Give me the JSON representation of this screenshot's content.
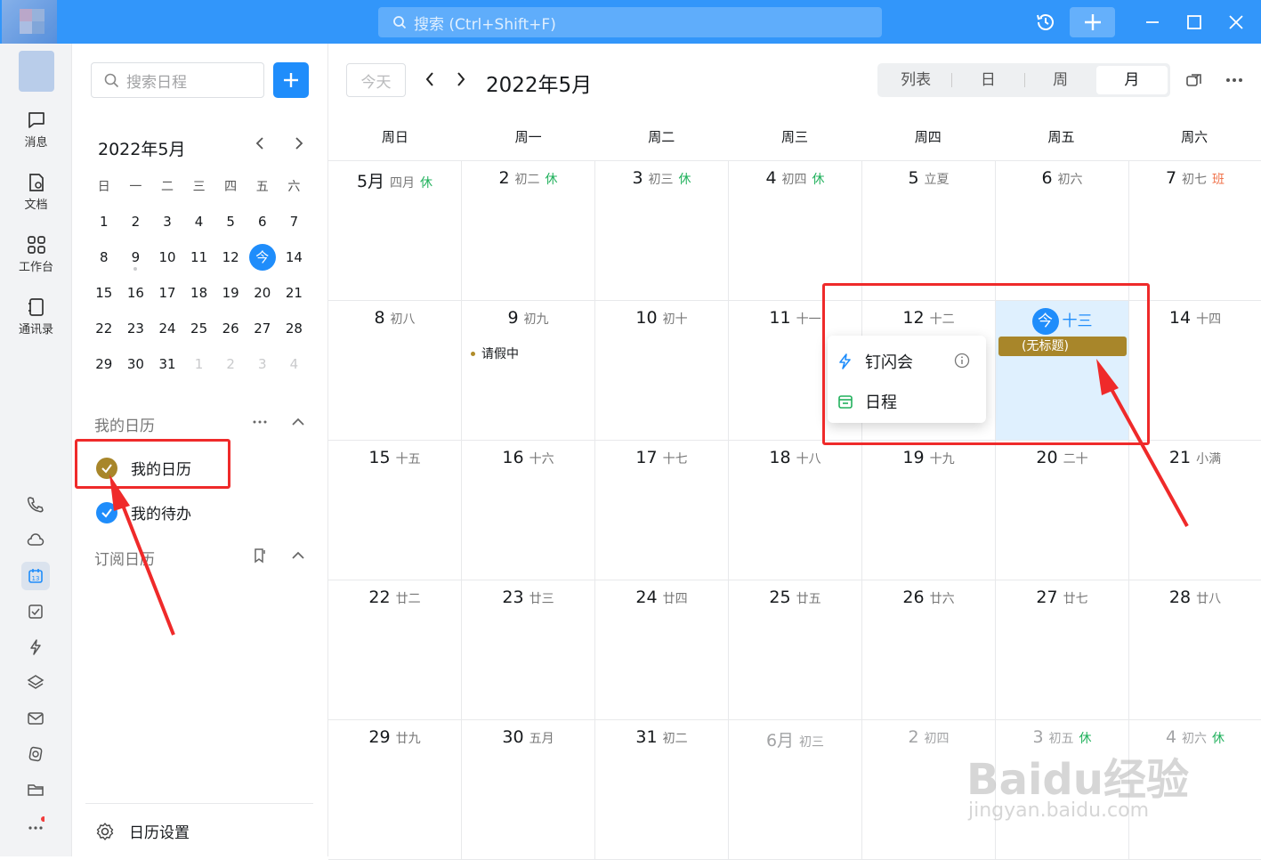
{
  "titlebar": {
    "search_placeholder": "搜索 (Ctrl+Shift+F)"
  },
  "leftnav": {
    "items": [
      {
        "label": "消息",
        "icon": "message-icon"
      },
      {
        "label": "文档",
        "icon": "doc-icon"
      },
      {
        "label": "工作台",
        "icon": "workbench-icon"
      },
      {
        "label": "通讯录",
        "icon": "contacts-icon"
      }
    ]
  },
  "sidebar": {
    "search_placeholder": "搜索日程",
    "mini_calendar": {
      "title": "2022年5月",
      "weekdays": [
        "日",
        "一",
        "二",
        "三",
        "四",
        "五",
        "六"
      ],
      "weeks": [
        [
          "1",
          "2",
          "3",
          "4",
          "5",
          "6",
          "7"
        ],
        [
          "8",
          "9",
          "10",
          "11",
          "12",
          "今",
          "14"
        ],
        [
          "15",
          "16",
          "17",
          "18",
          "19",
          "20",
          "21"
        ],
        [
          "22",
          "23",
          "24",
          "25",
          "26",
          "27",
          "28"
        ],
        [
          "29",
          "30",
          "31",
          "1",
          "2",
          "3",
          "4"
        ]
      ]
    },
    "my_calendars_title": "我的日历",
    "my_calendars": [
      {
        "label": "我的日历",
        "color": "#a8862a"
      },
      {
        "label": "我的待办",
        "color": "#1f8dfb"
      }
    ],
    "subscribed_title": "订阅日历",
    "settings_label": "日历设置"
  },
  "main": {
    "today_button": "今天",
    "title": "2022年5月",
    "views": [
      "列表",
      "日",
      "周",
      "月"
    ],
    "active_view": "月",
    "weekday_headers": [
      "周日",
      "周一",
      "周二",
      "周三",
      "周四",
      "周五",
      "周六"
    ],
    "weeks": [
      [
        {
          "num": "5月",
          "lunar": "四月",
          "tag": "休",
          "tag_type": "hol"
        },
        {
          "num": "2",
          "lunar": "初二",
          "tag": "休",
          "tag_type": "hol"
        },
        {
          "num": "3",
          "lunar": "初三",
          "tag": "休",
          "tag_type": "hol"
        },
        {
          "num": "4",
          "lunar": "初四",
          "tag": "休",
          "tag_type": "hol"
        },
        {
          "num": "5",
          "lunar": "立夏",
          "tag": "",
          "tag_type": ""
        },
        {
          "num": "6",
          "lunar": "初六",
          "tag": "",
          "tag_type": ""
        },
        {
          "num": "7",
          "lunar": "初七",
          "tag": "班",
          "tag_type": "ban"
        }
      ],
      [
        {
          "num": "8",
          "lunar": "初八",
          "tag": "",
          "tag_type": ""
        },
        {
          "num": "9",
          "lunar": "初九",
          "tag": "",
          "tag_type": ""
        },
        {
          "num": "10",
          "lunar": "初十",
          "tag": "",
          "tag_type": ""
        },
        {
          "num": "11",
          "lunar": "十一",
          "tag": "",
          "tag_type": ""
        },
        {
          "num": "12",
          "lunar": "十二",
          "tag": "",
          "tag_type": ""
        },
        {
          "num": "今",
          "lunar": "十三",
          "tag": "",
          "tag_type": "today"
        },
        {
          "num": "14",
          "lunar": "十四",
          "tag": "",
          "tag_type": ""
        }
      ],
      [
        {
          "num": "15",
          "lunar": "十五",
          "tag": "",
          "tag_type": ""
        },
        {
          "num": "16",
          "lunar": "十六",
          "tag": "",
          "tag_type": ""
        },
        {
          "num": "17",
          "lunar": "十七",
          "tag": "",
          "tag_type": ""
        },
        {
          "num": "18",
          "lunar": "十八",
          "tag": "",
          "tag_type": ""
        },
        {
          "num": "19",
          "lunar": "十九",
          "tag": "",
          "tag_type": ""
        },
        {
          "num": "20",
          "lunar": "二十",
          "tag": "",
          "tag_type": ""
        },
        {
          "num": "21",
          "lunar": "小满",
          "tag": "",
          "tag_type": ""
        }
      ],
      [
        {
          "num": "22",
          "lunar": "廿二",
          "tag": "",
          "tag_type": ""
        },
        {
          "num": "23",
          "lunar": "廿三",
          "tag": "",
          "tag_type": ""
        },
        {
          "num": "24",
          "lunar": "廿四",
          "tag": "",
          "tag_type": ""
        },
        {
          "num": "25",
          "lunar": "廿五",
          "tag": "",
          "tag_type": ""
        },
        {
          "num": "26",
          "lunar": "廿六",
          "tag": "",
          "tag_type": ""
        },
        {
          "num": "27",
          "lunar": "廿七",
          "tag": "",
          "tag_type": ""
        },
        {
          "num": "28",
          "lunar": "廿八",
          "tag": "",
          "tag_type": ""
        }
      ],
      [
        {
          "num": "29",
          "lunar": "廿九",
          "tag": "",
          "tag_type": ""
        },
        {
          "num": "30",
          "lunar": "五月",
          "tag": "",
          "tag_type": ""
        },
        {
          "num": "31",
          "lunar": "初二",
          "tag": "",
          "tag_type": ""
        },
        {
          "num": "6月",
          "lunar": "初三",
          "tag": "",
          "tag_type": "dim"
        },
        {
          "num": "2",
          "lunar": "初四",
          "tag": "",
          "tag_type": "dim"
        },
        {
          "num": "3",
          "lunar": "初五",
          "tag": "休",
          "tag_type": "dimhol"
        },
        {
          "num": "4",
          "lunar": "初六",
          "tag": "休",
          "tag_type": "dimhol"
        }
      ]
    ],
    "events": {
      "leave": "请假中",
      "untitled": "(无标题)"
    },
    "popup": {
      "item1": "钉闪会",
      "item2": "日程"
    }
  },
  "watermark": {
    "line1": "Baidu经验",
    "line2": "jingyan.baidu.com"
  }
}
